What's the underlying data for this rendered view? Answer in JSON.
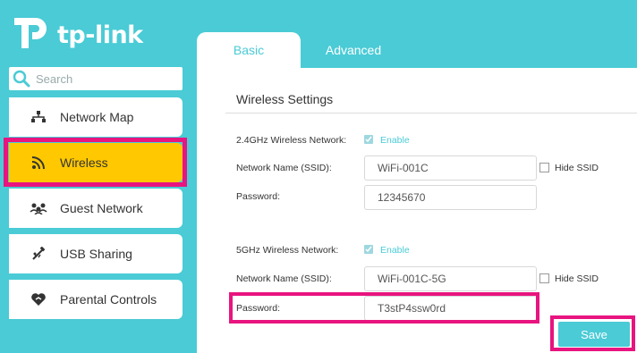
{
  "brand": {
    "logo_text": "tp-link"
  },
  "search": {
    "placeholder": "Search"
  },
  "sidebar": {
    "items": [
      {
        "label": "Network Map",
        "icon": "network-map-icon"
      },
      {
        "label": "Wireless",
        "icon": "wireless-icon",
        "active": true
      },
      {
        "label": "Guest Network",
        "icon": "guest-network-icon"
      },
      {
        "label": "USB Sharing",
        "icon": "usb-icon"
      },
      {
        "label": "Parental Controls",
        "icon": "parental-controls-icon"
      }
    ]
  },
  "tabs": [
    {
      "label": "Basic",
      "active": true
    },
    {
      "label": "Advanced",
      "active": false
    }
  ],
  "main": {
    "section_title": "Wireless Settings",
    "band24": {
      "network_label": "2.4GHz Wireless Network:",
      "enable_label": "Enable",
      "enabled": true,
      "ssid_label": "Network Name (SSID):",
      "ssid_value": "WiFi-001C",
      "hide_ssid_label": "Hide SSID",
      "password_label": "Password:",
      "password_value": "12345670"
    },
    "band5": {
      "network_label": "5GHz Wireless Network:",
      "enable_label": "Enable",
      "enabled": true,
      "ssid_label": "Network Name (SSID):",
      "ssid_value": "WiFi-001C-5G",
      "hide_ssid_label": "Hide SSID",
      "password_label": "Password:",
      "password_value": "T3stP4ssw0rd"
    },
    "save_label": "Save"
  },
  "colors": {
    "accent": "#4acbd6",
    "active": "#ffc800",
    "highlight": "#e8147f"
  }
}
